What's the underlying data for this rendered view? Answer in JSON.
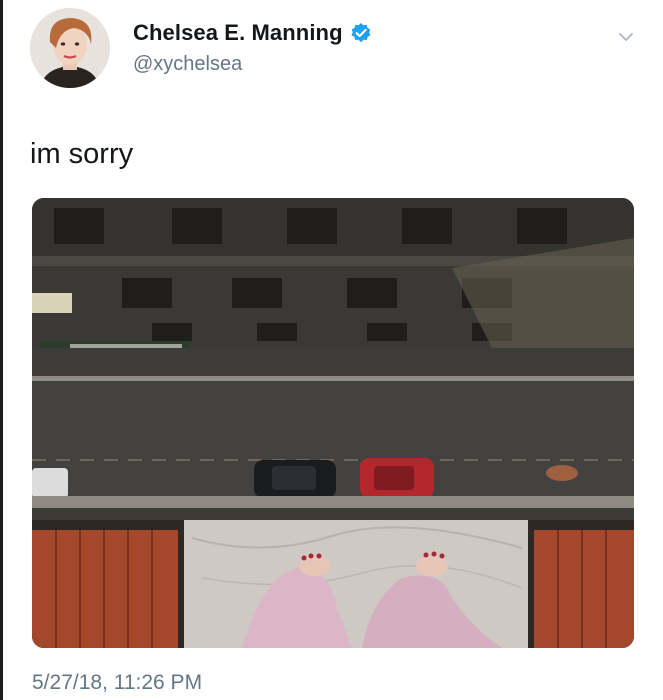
{
  "tweet": {
    "display_name": "Chelsea E. Manning",
    "handle": "@xychelsea",
    "verified": true,
    "text": "im sorry",
    "timestamp": "5/27/18, 11:26 PM"
  },
  "icons": {
    "verified": "verified-badge-icon",
    "more": "chevron-down-icon"
  },
  "colors": {
    "accent": "#1da1f2",
    "secondary_text": "#657786",
    "primary_text": "#14171a"
  }
}
